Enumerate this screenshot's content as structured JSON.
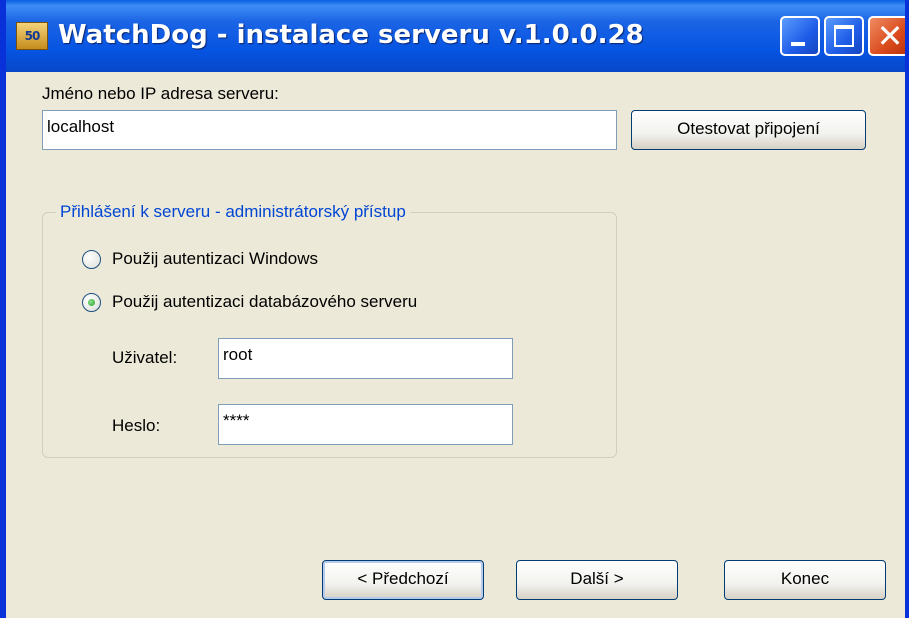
{
  "window": {
    "title": "WatchDog - instalace serveru v.1.0.0.28",
    "icon": "watchdog-app-icon"
  },
  "server": {
    "label": "Jméno nebo IP adresa serveru:",
    "value": "localhost",
    "test_button": "Otestovat připojení"
  },
  "login": {
    "group_title": "Přihlášení k serveru - administrátorský přístup",
    "options": [
      {
        "label": "Použij autentizaci Windows",
        "selected": false
      },
      {
        "label": "Použij autentizaci databázového serveru",
        "selected": true
      }
    ],
    "user_label": "Uživatel:",
    "user_value": "root",
    "password_label": "Heslo:",
    "password_value": "****"
  },
  "footer": {
    "prev": "< Předchozí",
    "next": "Další >",
    "finish": "Konec"
  },
  "colors": {
    "titlebar": "#0654e2",
    "dialog_bg": "#ece9d8",
    "group_title": "#0046d5",
    "close_button": "#d9491b"
  }
}
